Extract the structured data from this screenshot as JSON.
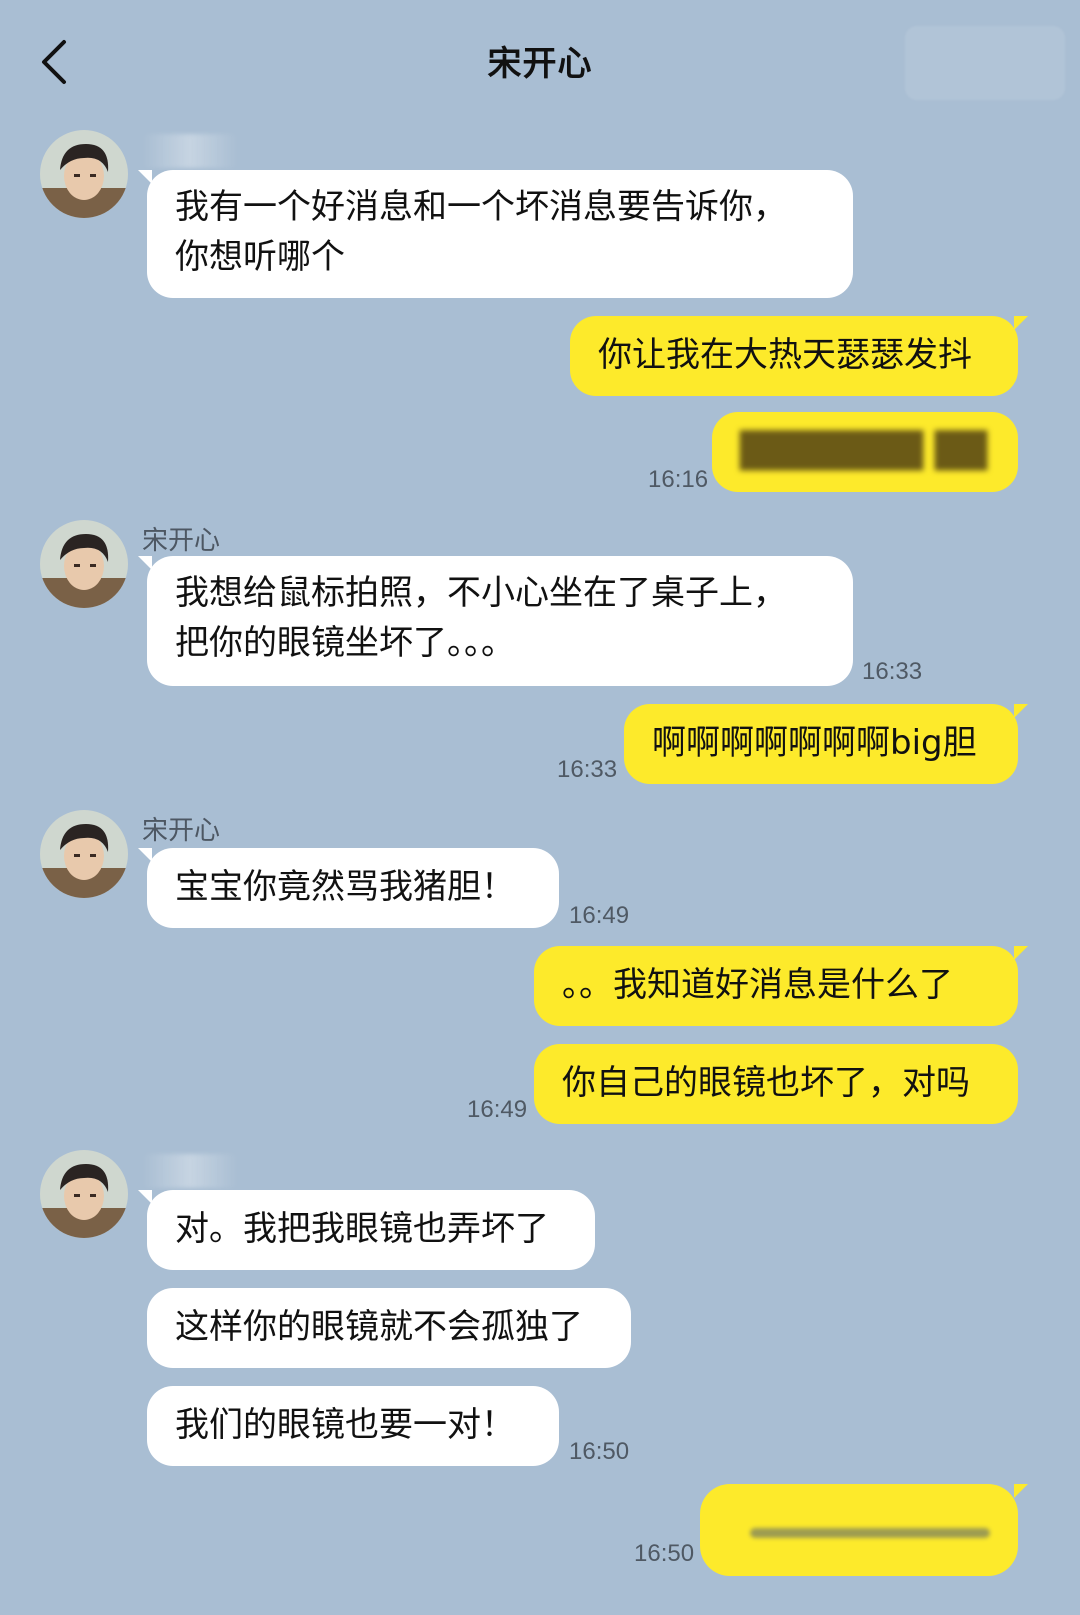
{
  "header": {
    "title": "宋开心"
  },
  "contact": {
    "name": "宋开心"
  },
  "messages": {
    "m1": "我有一个好消息和一个坏消息要告诉你，",
    "m1b": "你想听哪个",
    "m2": "你让我在大热天瑟瑟发抖",
    "m3": "███████ ██",
    "t1": "16:16",
    "m4": "我想给鼠标拍照，不小心坐在了桌子上，",
    "m4b": "把你的眼镜坐坏了。。。",
    "t2": "16:33",
    "m5": "啊啊啊啊啊啊啊big胆",
    "t3": "16:33",
    "m6": "宝宝你竟然骂我猪胆！",
    "t4": "16:49",
    "m7": "。。我知道好消息是什么了",
    "m8": "你自己的眼镜也坏了，对吗",
    "t5": "16:49",
    "m9": "对。我把我眼镜也弄坏了",
    "m10": "这样你的眼镜就不会孤独了",
    "m11": "我们的眼镜也要一对！",
    "t6": "16:50",
    "t7": "16:50"
  },
  "colors": {
    "background": "#a9bed3",
    "incoming_bubble": "#ffffff",
    "outgoing_bubble": "#fdea2b"
  }
}
